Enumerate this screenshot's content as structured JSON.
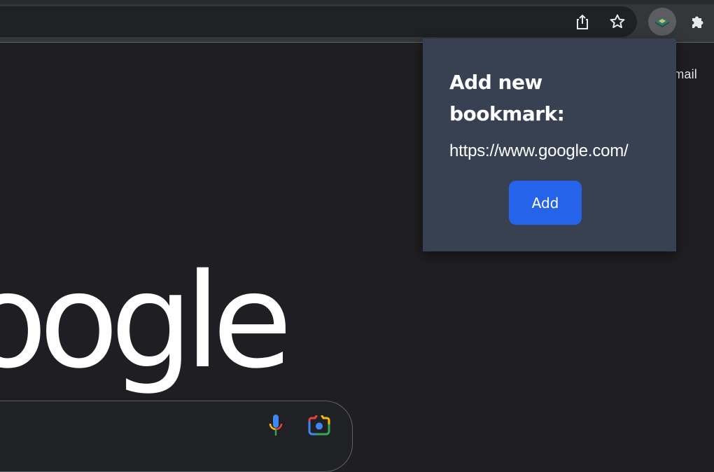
{
  "browser": {
    "toolbar": {
      "share_icon": "share-icon",
      "bookmark_star_icon": "star-outline-icon",
      "extension_icon": "bookmark-extension-icon",
      "extensions_icon": "puzzle-piece-icon"
    }
  },
  "page": {
    "gmail_link": "Gmail",
    "logo_text": "oogle",
    "search": {
      "mic_icon": "microphone-icon",
      "lens_icon": "camera-lens-icon"
    }
  },
  "popup": {
    "title": "Add new bookmark:",
    "url": "https://www.google.com/",
    "add_button": "Add"
  },
  "colors": {
    "popup_bg": "#374151",
    "add_button_bg": "#2563eb",
    "page_bg": "#1f1f23",
    "toolbar_bg": "#35363a"
  }
}
